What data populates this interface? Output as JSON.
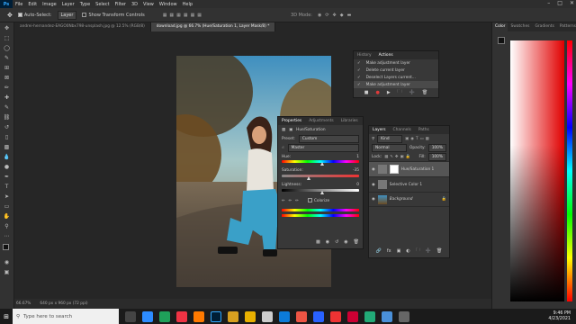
{
  "menu": {
    "app_icon": "Ps",
    "items": [
      "File",
      "Edit",
      "Image",
      "Layer",
      "Type",
      "Select",
      "Filter",
      "3D",
      "View",
      "Window",
      "Help"
    ]
  },
  "options_bar": {
    "auto_select_label": "Auto-Select:",
    "auto_select_value": "Layer",
    "show_transform_label": "Show Transform Controls",
    "mode_3d_label": "3D Mode:"
  },
  "documents": {
    "tabs": [
      "andrei-hernandez-EAGO0Nbx798-unsplash.jpg @ 12.5% (RGB/8)",
      "download.jpg @ 66.7% (Hue/Saturation 1, Layer Mask/8) *"
    ],
    "active_index": 1
  },
  "status": {
    "zoom": "66.67%",
    "doc_info": "640 px x 960 px (72 ppi)"
  },
  "right_dock": {
    "tabs": [
      "Color",
      "Swatches",
      "Gradients",
      "Patterns"
    ],
    "active_tab": "Color"
  },
  "history_panel": {
    "tabs": [
      "History",
      "Actions"
    ],
    "active_tab": "Actions",
    "items": [
      "Make adjustment layer",
      "Delete current layer",
      "Deselect Layers current...",
      "Make adjustment layer"
    ]
  },
  "properties": {
    "tabs": [
      "Properties",
      "Adjustments",
      "Libraries"
    ],
    "active_tab": "Properties",
    "title": "Hue/Saturation",
    "preset_label": "Preset:",
    "preset_value": "Custom",
    "channel_value": "Master",
    "hue_label": "Hue:",
    "hue_value": "1",
    "saturation_label": "Saturation:",
    "saturation_value": "-35",
    "lightness_label": "Lightness:",
    "lightness_value": "0",
    "colorize_label": "Colorize"
  },
  "layers": {
    "tabs": [
      "Layers",
      "Channels",
      "Paths"
    ],
    "active_tab": "Layers",
    "kind_label": "Kind",
    "blend_mode": "Normal",
    "opacity_label": "Opacity:",
    "opacity_value": "100%",
    "lock_label": "Lock:",
    "fill_label": "Fill:",
    "fill_value": "100%",
    "items": [
      {
        "name": "Hue/Saturation 1",
        "selected": true
      },
      {
        "name": "Selective Color 1",
        "selected": false
      },
      {
        "name": "Background",
        "selected": false
      }
    ]
  },
  "taskbar": {
    "search_placeholder": "Type here to search",
    "time": "9:46 PM",
    "date": "4/23/2021"
  }
}
